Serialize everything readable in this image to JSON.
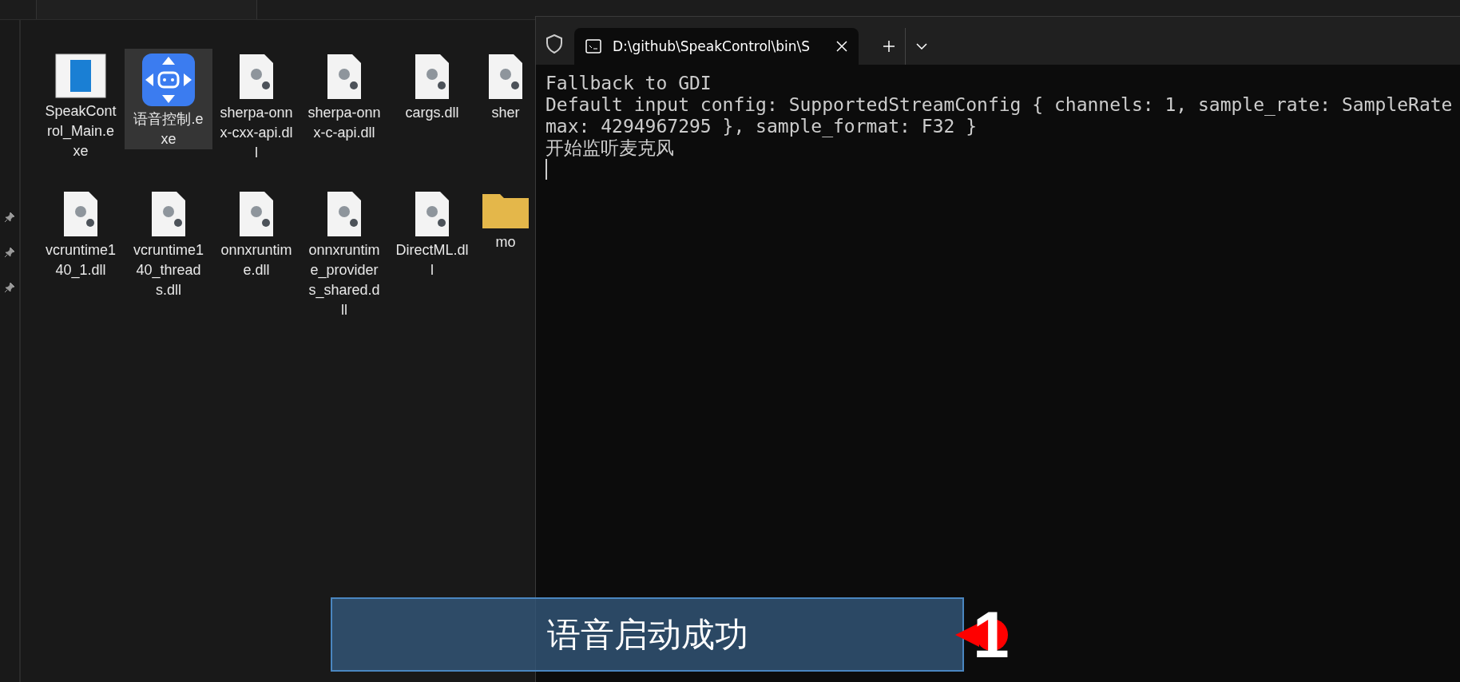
{
  "explorer": {
    "files": [
      {
        "name": "SpeakControl_Main.exe",
        "kind": "app",
        "selected": false
      },
      {
        "name": "语音控制.exe",
        "kind": "robot",
        "selected": true
      },
      {
        "name": "sherpa-onnx-cxx-api.dll",
        "kind": "dll",
        "selected": false
      },
      {
        "name": "sherpa-onnx-c-api.dll",
        "kind": "dll",
        "selected": false
      },
      {
        "name": "cargs.dll",
        "kind": "dll",
        "selected": false
      },
      {
        "name": "sher",
        "kind": "dll",
        "selected": false
      },
      {
        "name": "vcruntime140_1.dll",
        "kind": "dll",
        "selected": false
      },
      {
        "name": "vcruntime140_threads.dll",
        "kind": "dll",
        "selected": false
      },
      {
        "name": "onnxruntime.dll",
        "kind": "dll",
        "selected": false
      },
      {
        "name": "onnxruntime_providers_shared.dll",
        "kind": "dll",
        "selected": false
      },
      {
        "name": "DirectML.dll",
        "kind": "dll",
        "selected": false
      },
      {
        "name": "mo",
        "kind": "folder",
        "selected": false
      }
    ]
  },
  "terminal": {
    "tab_title": "D:\\github\\SpeakControl\\bin\\S",
    "lines": [
      "Fallback to GDI",
      "Default input config: SupportedStreamConfig { channels: 1, sample_rate: SampleRate",
      "max: 4294967295 }, sample_format: F32 }",
      "开始监听麦克风"
    ]
  },
  "toast": {
    "message": "语音启动成功"
  },
  "badge": {
    "number": "1"
  }
}
